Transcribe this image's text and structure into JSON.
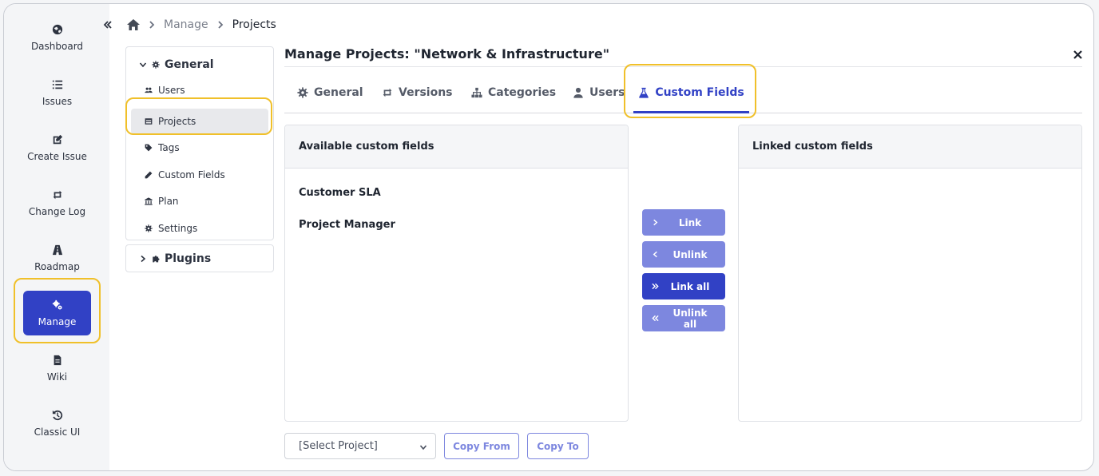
{
  "nav": {
    "collapse_icon": "double-chevron-left-icon",
    "items": [
      {
        "label": "Dashboard",
        "icon": "globe-icon"
      },
      {
        "label": "Issues",
        "icon": "list-icon"
      },
      {
        "label": "Create Issue",
        "icon": "edit-icon"
      },
      {
        "label": "Change Log",
        "icon": "repeat-icon"
      },
      {
        "label": "Roadmap",
        "icon": "road-icon"
      },
      {
        "label": "Manage",
        "icon": "cogs-icon",
        "active": true
      },
      {
        "label": "Wiki",
        "icon": "file-icon"
      },
      {
        "label": "Classic UI",
        "icon": "history-icon"
      }
    ]
  },
  "breadcrumb": {
    "items": [
      "Manage",
      "Projects"
    ]
  },
  "submenu": {
    "general_label": "General",
    "items": [
      {
        "label": "Users",
        "icon": "users-icon"
      },
      {
        "label": "Projects",
        "icon": "table-icon",
        "active": true
      },
      {
        "label": "Tags",
        "icon": "tag-icon"
      },
      {
        "label": "Custom Fields",
        "icon": "pencil-icon"
      },
      {
        "label": "Plan",
        "icon": "bank-icon"
      },
      {
        "label": "Settings",
        "icon": "gear-icon"
      }
    ],
    "plugins_label": "Plugins"
  },
  "main": {
    "title": "Manage Projects: \"Network & Infrastructure\"",
    "tabs": [
      {
        "label": "General",
        "icon": "gear-icon"
      },
      {
        "label": "Versions",
        "icon": "repeat-icon"
      },
      {
        "label": "Categories",
        "icon": "sitemap-icon"
      },
      {
        "label": "Users",
        "icon": "user-icon"
      },
      {
        "label": "Custom Fields",
        "icon": "flask-icon",
        "active": true
      }
    ],
    "available": {
      "header": "Available custom fields",
      "items": [
        "Customer SLA",
        "Project Manager"
      ]
    },
    "linked": {
      "header": "Linked custom fields",
      "items": []
    },
    "actions": {
      "link": "Link",
      "unlink": "Unlink",
      "link_all": "Link all",
      "unlink_all": "Unlink all"
    },
    "footer": {
      "select_value": "[Select Project]",
      "copy_from": "Copy From",
      "copy_to": "Copy To"
    }
  },
  "colors": {
    "accent": "#3141c5",
    "accent_light": "#7d87df",
    "highlight": "#f0c02a"
  }
}
